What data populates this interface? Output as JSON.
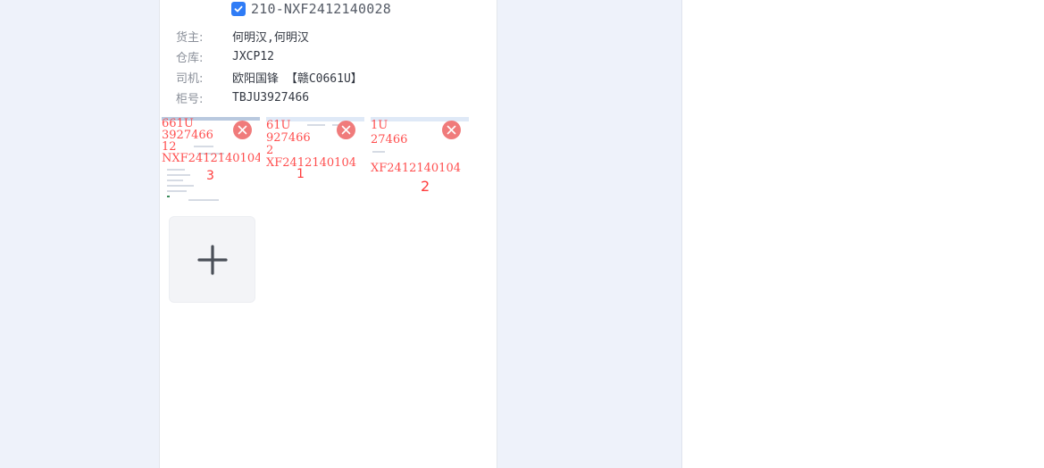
{
  "order": {
    "number": "210-NXF2412140028",
    "checked": true
  },
  "info": [
    {
      "label": "货主:",
      "value": "何明汉,何明汉"
    },
    {
      "label": "仓库:",
      "value": "JXCP12"
    },
    {
      "label": "司机:",
      "value": "欧阳国锋 【赣C0661U】"
    },
    {
      "label": "柜号:",
      "value": "TBJU3927466"
    }
  ],
  "thumbnails": [
    {
      "lines": [
        "661U",
        "3927466",
        "12",
        "NXF2412140104"
      ],
      "number": "3"
    },
    {
      "lines": [
        "61U",
        "927466",
        "2",
        "XF2412140104"
      ],
      "number": "1"
    },
    {
      "lines": [
        "1U",
        "27466",
        "",
        "XF2412140104"
      ],
      "number": "2"
    }
  ],
  "icons": {
    "check": "check-icon",
    "delete": "close-circle-icon",
    "add": "plus-icon"
  },
  "colors": {
    "accent": "#2f7cf6",
    "delete": "#f07b7b",
    "watermark": "#ff3b3b"
  }
}
